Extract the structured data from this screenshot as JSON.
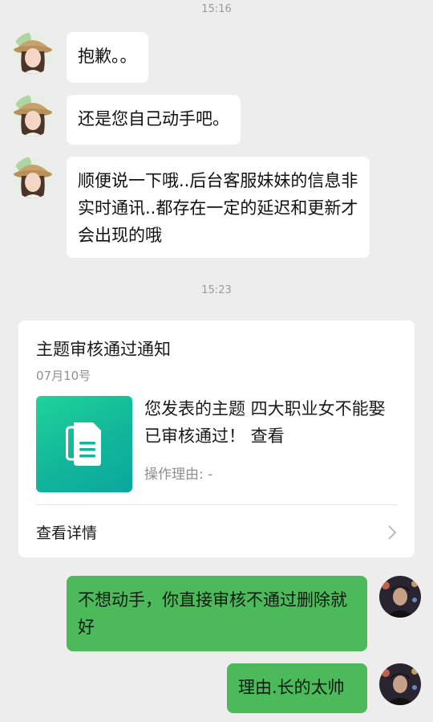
{
  "times": [
    "15:16",
    "15:23"
  ],
  "messages": [
    {
      "sender": "service",
      "text": "抱歉。。"
    },
    {
      "sender": "service",
      "text": "还是您自己动手吧。"
    },
    {
      "sender": "service",
      "text": "顺便说一下哦..后台客服妹妹的信息非实时通讯..都存在一定的延迟和更新才会出现的哦"
    },
    {
      "sender": "me",
      "text": "不想动手，你直接审核不通过删除就好"
    },
    {
      "sender": "me",
      "text": "理由.长的太帅"
    }
  ],
  "card": {
    "title": "主题审核通过通知",
    "date": "07月10号",
    "message": "您发表的主题 四大职业女不能娶 已审核通过！ 查看",
    "reason": "操作理由: -",
    "details_label": "查看详情",
    "icon": "document-icon"
  },
  "colors": {
    "background": "#ededed",
    "my_bubble": "#4cb95a",
    "their_bubble": "#ffffff",
    "card_icon": "#12b69a"
  }
}
